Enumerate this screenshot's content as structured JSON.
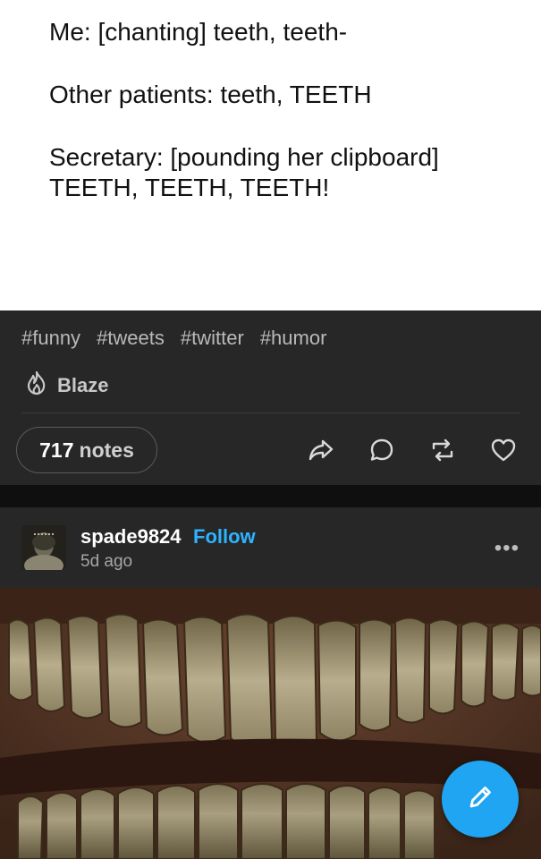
{
  "tweet": {
    "line1": "Me: [chanting] teeth, teeth-",
    "line2": "Other patients: teeth, TEETH",
    "line3": "Secretary: [pounding her clipboard]",
    "line4": "TEETH, TEETH, TEETH!"
  },
  "post": {
    "tags": [
      "#funny",
      "#tweets",
      "#twitter",
      "#humor"
    ],
    "blaze_label": "Blaze",
    "notes_count": "717",
    "notes_label": "notes",
    "actions": [
      "share-icon",
      "reply-icon",
      "reblog-icon",
      "like-icon"
    ]
  },
  "next_post": {
    "username": "spade9824",
    "follow_label": "Follow",
    "time": "5d ago",
    "more_label": "•••"
  },
  "colors": {
    "background": "#272727",
    "accent": "#2eb3ff",
    "fab": "#1fa5f2"
  }
}
